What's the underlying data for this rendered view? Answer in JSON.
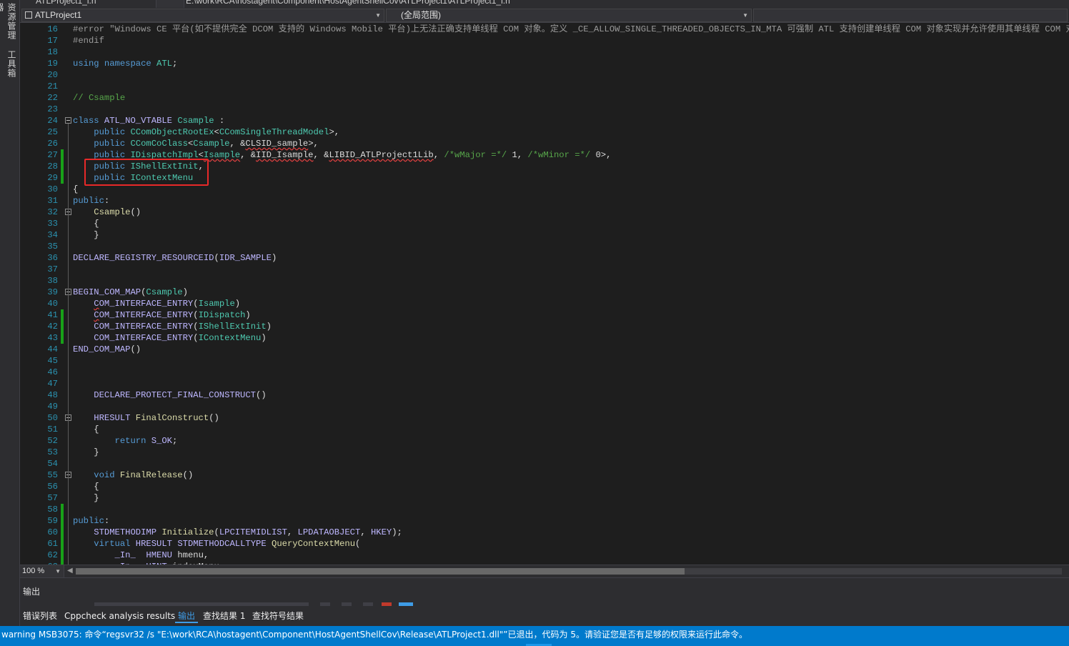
{
  "left_strip": {
    "tab1": "资源管理器",
    "tab2": "工具箱"
  },
  "top_tabs": {
    "file_tab": "ATLProject1_i.h",
    "path": "E:\\work\\RCA\\hostagent\\Component\\HostAgentShellCov\\ATLProject1\\ATLProject1_i.h"
  },
  "navbar": {
    "project": "ATLProject1",
    "scope": "(全局范围)"
  },
  "editor": {
    "highlight_color": "#e82929",
    "change_marker_color": "#18a118",
    "lines": [
      {
        "n": "16",
        "changed": false,
        "fold": false,
        "html": "<span class='pp'>#error \"Windows CE 平台(如不提供完全 DCOM 支持的 Windows Mobile 平台)上无法正确支持单线程 COM 对象。定义 _CE_ALLOW_SINGLE_THREADED_OBJECTS_IN_MTA 可强制 ATL 支持创建单线程 COM 对象实现并允许使用其单线程 COM 对象实现。rgs 文件中的线程模型已被设置为“Free”</span>"
      },
      {
        "n": "17",
        "changed": false,
        "fold": false,
        "html": "<span class='pp'>#endif</span>"
      },
      {
        "n": "18",
        "changed": false,
        "fold": false,
        "html": ""
      },
      {
        "n": "19",
        "changed": false,
        "fold": false,
        "html": "<span class='kw'>using namespace</span> <span class='ty'>ATL</span>;"
      },
      {
        "n": "20",
        "changed": false,
        "fold": false,
        "html": ""
      },
      {
        "n": "21",
        "changed": false,
        "fold": false,
        "html": ""
      },
      {
        "n": "22",
        "changed": false,
        "fold": false,
        "html": "<span class='cm'>// Csample</span>"
      },
      {
        "n": "23",
        "changed": false,
        "fold": false,
        "html": ""
      },
      {
        "n": "24",
        "changed": false,
        "fold": true,
        "html": "<span class='kw'>class</span> <span class='mc'>ATL_NO_VTABLE</span> <span class='ty'>Csample</span> :"
      },
      {
        "n": "25",
        "changed": false,
        "fold": false,
        "html": "    <span class='kw'>public</span> <span class='ty'>CComObjectRootEx</span>&lt;<span class='ty'>CComSingleThreadModel</span>&gt;,"
      },
      {
        "n": "26",
        "changed": false,
        "fold": false,
        "html": "    <span class='kw'>public</span> <span class='ty'>CComCoClass</span>&lt;<span class='ty'>Csample</span>, &amp;<span class='squig'>CLSID_sample</span>&gt;,"
      },
      {
        "n": "27",
        "changed": true,
        "fold": false,
        "html": "    <span class='kw'>public</span> <span class='ty'>IDispatchImpl</span>&lt;<span class='ty squig'>Isample</span>, &amp;<span class='squig'>IID_Isample</span>, &amp;<span class='squig'>LIBID_ATLProject1Lib</span>, <span class='cm'>/*wMajor =*/</span> 1, <span class='cm'>/*wMinor =*/</span> 0&gt;,"
      },
      {
        "n": "28",
        "changed": true,
        "fold": false,
        "html": "    <span class='kw'>public</span> <span class='ty'>IShellExtInit</span>,"
      },
      {
        "n": "29",
        "changed": true,
        "fold": false,
        "html": "    <span class='kw'>public</span> <span class='ty'>IContextMenu</span>"
      },
      {
        "n": "30",
        "changed": false,
        "fold": false,
        "html": "{"
      },
      {
        "n": "31",
        "changed": false,
        "fold": false,
        "html": "<span class='kw'>public</span>:"
      },
      {
        "n": "32",
        "changed": false,
        "fold": true,
        "html": "    <span class='fn'>Csample</span>()"
      },
      {
        "n": "33",
        "changed": false,
        "fold": false,
        "html": "    {"
      },
      {
        "n": "34",
        "changed": false,
        "fold": false,
        "html": "    }"
      },
      {
        "n": "35",
        "changed": false,
        "fold": false,
        "html": ""
      },
      {
        "n": "36",
        "changed": false,
        "fold": false,
        "html": "<span class='mc'>DECLARE_REGISTRY_RESOURCEID</span>(<span class='mc'>IDR_SAMPLE</span>)"
      },
      {
        "n": "37",
        "changed": false,
        "fold": false,
        "html": ""
      },
      {
        "n": "38",
        "changed": false,
        "fold": false,
        "html": ""
      },
      {
        "n": "39",
        "changed": false,
        "fold": true,
        "html": "<span class='mc'>BEGIN_COM_MAP</span>(<span class='ty'>Csample</span>)"
      },
      {
        "n": "40",
        "changed": false,
        "fold": false,
        "html": "    <span class='mc'><span class='squig'>C</span>OM_INTERFACE_ENTRY</span>(<span class='ty'>Isample</span>)"
      },
      {
        "n": "41",
        "changed": true,
        "fold": false,
        "html": "    <span class='mc'><span class='squig'>C</span>OM_INTERFACE_ENTRY</span>(<span class='ty'>IDispatch</span>)"
      },
      {
        "n": "42",
        "changed": true,
        "fold": false,
        "html": "    <span class='mc'>COM_INTERFACE_ENTRY</span>(<span class='ty'>IShellExtInit</span>)"
      },
      {
        "n": "43",
        "changed": true,
        "fold": false,
        "html": "    <span class='mc'>COM_INTERFACE_ENTRY</span>(<span class='ty'>IContextMenu</span>)"
      },
      {
        "n": "44",
        "changed": false,
        "fold": false,
        "html": "<span class='mc'>END_COM_MAP</span>()"
      },
      {
        "n": "45",
        "changed": false,
        "fold": false,
        "html": ""
      },
      {
        "n": "46",
        "changed": false,
        "fold": false,
        "html": ""
      },
      {
        "n": "47",
        "changed": false,
        "fold": false,
        "html": ""
      },
      {
        "n": "48",
        "changed": false,
        "fold": false,
        "html": "    <span class='mc'>DECLARE_PROTECT_FINAL_CONSTRUCT</span>()"
      },
      {
        "n": "49",
        "changed": false,
        "fold": false,
        "html": ""
      },
      {
        "n": "50",
        "changed": false,
        "fold": true,
        "html": "    <span class='mc'>HRESULT</span> <span class='fn'>FinalConstruct</span>()"
      },
      {
        "n": "51",
        "changed": false,
        "fold": false,
        "html": "    {"
      },
      {
        "n": "52",
        "changed": false,
        "fold": false,
        "html": "        <span class='kw'>return</span> <span class='mc'>S_OK</span>;"
      },
      {
        "n": "53",
        "changed": false,
        "fold": false,
        "html": "    }"
      },
      {
        "n": "54",
        "changed": false,
        "fold": false,
        "html": ""
      },
      {
        "n": "55",
        "changed": false,
        "fold": true,
        "html": "    <span class='kw'>void</span> <span class='fn'>FinalRelease</span>()"
      },
      {
        "n": "56",
        "changed": false,
        "fold": false,
        "html": "    {"
      },
      {
        "n": "57",
        "changed": false,
        "fold": false,
        "html": "    }"
      },
      {
        "n": "58",
        "changed": true,
        "fold": false,
        "html": ""
      },
      {
        "n": "59",
        "changed": true,
        "fold": false,
        "html": "<span class='kw'>public</span>:"
      },
      {
        "n": "60",
        "changed": true,
        "fold": false,
        "html": "    <span class='mc'>STDMETHODIMP</span> <span class='fn'>Initialize</span>(<span class='mc'>LPCITEMIDLIST</span>, <span class='mc'>LPDATAOBJECT</span>, <span class='mc'>HKEY</span>);"
      },
      {
        "n": "61",
        "changed": true,
        "fold": false,
        "html": "    <span class='kw'>virtual</span> <span class='mc'>HRESULT</span> <span class='mc'>STDMETHODCALLTYPE</span> <span class='fn'>QueryContextMenu</span>("
      },
      {
        "n": "62",
        "changed": true,
        "fold": false,
        "html": "        <span class='mc'>_In_</span>  <span class='mc'>HMENU</span> hmenu,"
      },
      {
        "n": "63",
        "changed": true,
        "fold": false,
        "html": "        <span class='mc'>_In_</span>  <span class='mc'>UINT</span> indexMenu,"
      }
    ]
  },
  "zoom": {
    "level": "100 %"
  },
  "output": {
    "title": "输出"
  },
  "bottom_tabs": [
    {
      "label": "错误列表",
      "active": false
    },
    {
      "label": "Cppcheck analysis results",
      "active": false
    },
    {
      "label": "输出",
      "active": true
    },
    {
      "label": "查找结果 1",
      "active": false
    },
    {
      "label": "查找符号结果",
      "active": false
    }
  ],
  "status": {
    "message": "warning MSB3075: 命令“regsvr32 /s \"E:\\work\\RCA\\hostagent\\Component\\HostAgentShellCov\\Release\\ATLProject1.dll\"”已退出，代码为 5。请验证您是否有足够的权限来运行此命令。",
    "accent": "#007acc"
  }
}
